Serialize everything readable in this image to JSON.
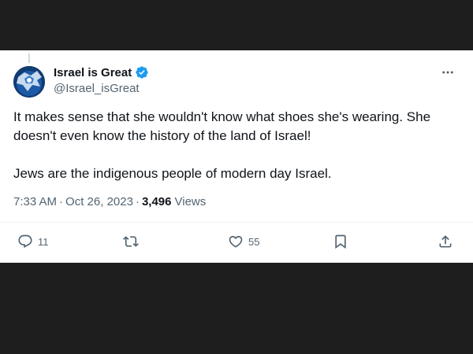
{
  "tweet": {
    "author": {
      "display_name": "Israel is Great",
      "handle": "@Israel_isGreat",
      "verified": true
    },
    "text_paragraphs": [
      "It makes sense that she wouldn't know what shoes she's wearing. She doesn't even know the history of the land of Israel!",
      "Jews are the indigenous people of modern day Israel."
    ],
    "time": "7:33 AM",
    "date": "Oct 26, 2023",
    "separator": "·",
    "views_count": "3,496",
    "views_label": "Views",
    "stats": {
      "replies": "11",
      "reposts": "",
      "likes": "55"
    }
  },
  "icons": {
    "more": "more-horizontal-icon",
    "reply": "reply-icon",
    "repost": "repost-icon",
    "like": "heart-icon",
    "bookmark": "bookmark-icon",
    "share": "share-icon",
    "verified": "verified-badge-icon"
  },
  "colors": {
    "verified_blue": "#1d9bf0",
    "text_primary": "#0f1419",
    "text_secondary": "#536471",
    "backdrop": "#1e1e1e"
  }
}
